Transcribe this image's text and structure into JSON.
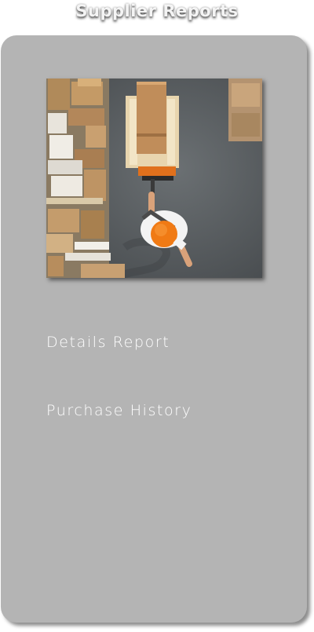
{
  "header": {
    "title": "Supplier Reports"
  },
  "hero_image": {
    "subject": "warehouse-worker-with-pallet-jack"
  },
  "menu": {
    "items": [
      {
        "label": "Details Report"
      },
      {
        "label": "Purchase History"
      }
    ]
  },
  "colors": {
    "card_background": "#b4b4b4",
    "title_text": "#f4f4f4",
    "menu_text": "#ffffff",
    "helmet": "#f07a14"
  }
}
